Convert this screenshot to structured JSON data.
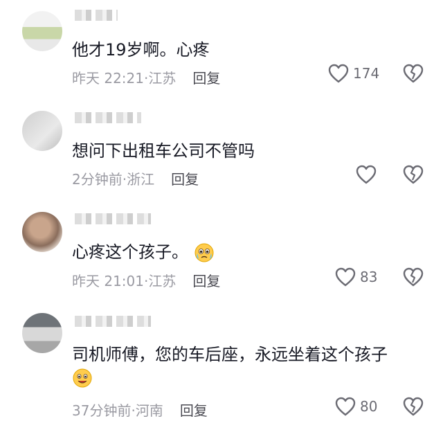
{
  "comments": [
    {
      "text": "他才19岁啊。心疼",
      "time": "昨天 22:21",
      "location": "江苏",
      "reply_label": "回复",
      "likes": "174"
    },
    {
      "text": "想问下出租车公司不管吗",
      "time": "2分钟前",
      "location": "浙江",
      "reply_label": "回复",
      "likes": ""
    },
    {
      "text": "心疼这个孩子。",
      "time": "昨天 21:01",
      "location": "江苏",
      "reply_label": "回复",
      "likes": "83",
      "emoji": "crying-pleading-emoji"
    },
    {
      "text": "司机师傅，您的车后座，永远坐着这个孩子",
      "time": "37分钟前",
      "location": "河南",
      "reply_label": "回复",
      "likes": "80",
      "emoji": "smiling-emoji"
    }
  ],
  "colors": {
    "text": "#161823",
    "meta": "#9a9aa2",
    "icon": "#6b6b73"
  }
}
